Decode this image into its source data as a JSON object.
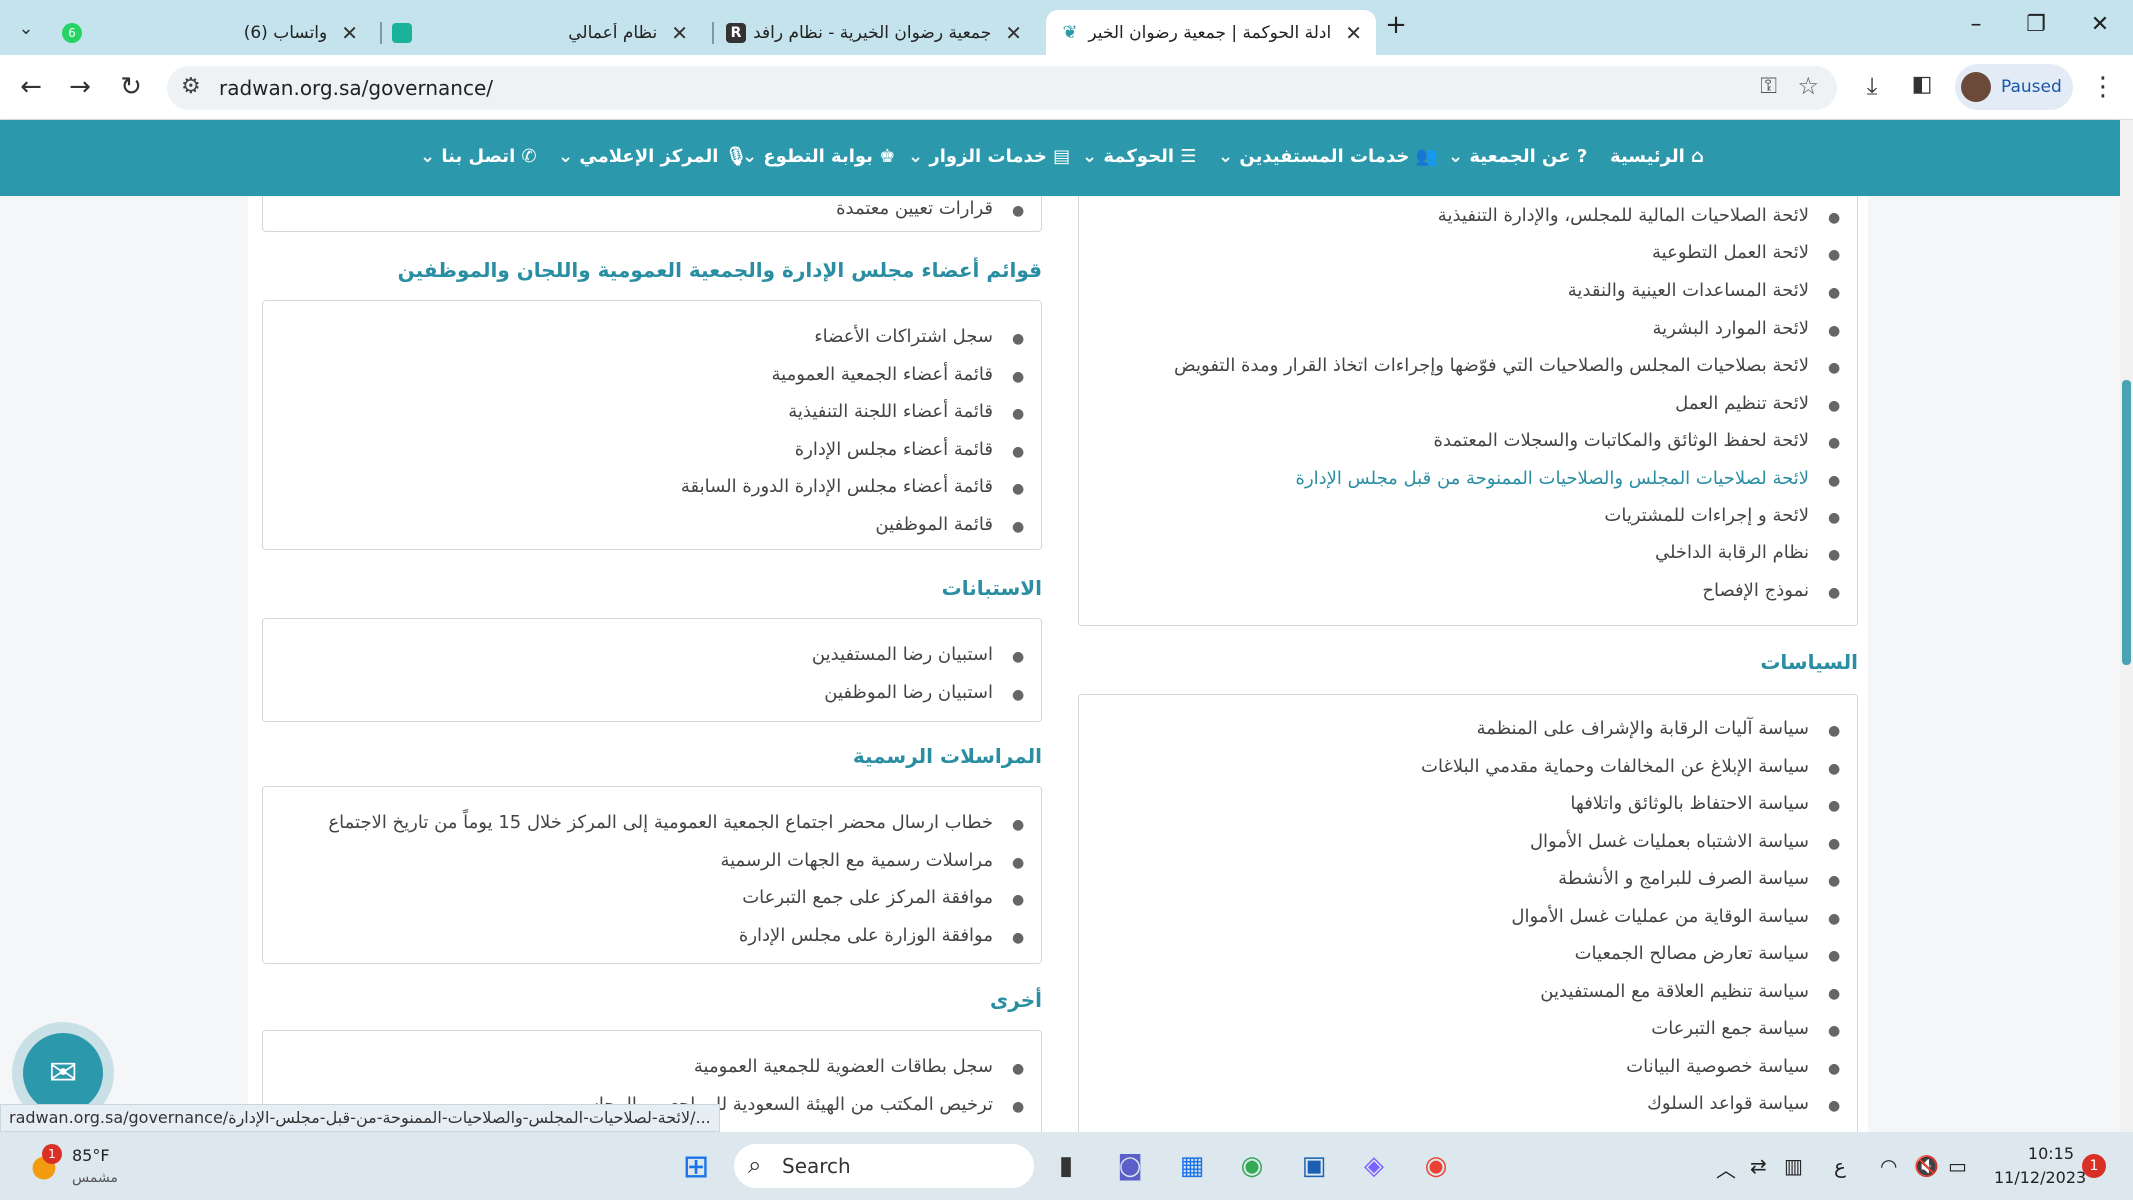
{
  "browser": {
    "tabs": [
      {
        "label": "(6) واتساب",
        "badge": "6"
      },
      {
        "label": "نظام أعمالي"
      },
      {
        "label": "جمعية رضوان الخيرية - نظام رافد"
      },
      {
        "label": "ادلة الحوكمة | جمعية رضوان الخير"
      }
    ],
    "new_tab": "+",
    "url": "radwan.org.sa/governance/",
    "profile": "Paused"
  },
  "menu": [
    "الرئيسية",
    "عن الجمعية",
    "خدمات المستفيدين",
    "الحوكمة",
    "خدمات الزوار",
    "بوابة التطوع",
    "المركز الإعلامي",
    "اتصل بنا"
  ],
  "right_col": {
    "regulations": [
      "لائحة الصلاحيات المالية للمجلس، والإدارة التنفيذية",
      "لائحة العمل التطوعية",
      "لائحة المساعدات العينية والنقدية",
      "لائحة الموارد البشرية",
      "لائحة بصلاحيات المجلس والصلاحيات التي فوّضها وإجراءات اتخاذ القرار ومدة التفويض",
      "لائحة تنظيم العمل",
      "لائحة لحفظ الوثائق والمكاتبات والسجلات المعتمدة",
      "لائحة لصلاحيات المجلس والصلاحيات الممنوحة من قبل مجلس الإدارة",
      "لائحة و إجراءات للمشتريات",
      "نظام الرقابة الداخلي",
      "نموذج الإفصاح"
    ],
    "policies_title": "السياسات",
    "policies": [
      "سياسة آليات الرقابة والإشراف على المنظمة",
      "سياسة الإبلاغ عن المخالفات وحماية مقدمي البلاغات",
      "سياسة الاحتفاظ بالوثائق واتلافها",
      "سياسة الاشتباه بعمليات غسل الأموال",
      "سياسة الصرف للبرامج و الأنشطة",
      "سياسة الوقاية من عمليات غسل الأموال",
      "سياسة تعارض مصالح الجمعيات",
      "سياسة تنظيم العلاقة مع المستفيدين",
      "سياسة جمع التبرعات",
      "سياسة خصوصية البيانات",
      "سياسة قواعد السلوك"
    ]
  },
  "left_col": {
    "top_item": "قرارات تعيين معتمدة",
    "lists_title": "قوائم أعضاء مجلس الإدارة والجمعية العمومية واللجان والموظفين",
    "lists": [
      "سجل اشتراكات الأعضاء",
      "قائمة أعضاء الجمعية العمومية",
      "قائمة أعضاء اللجنة التنفيذية",
      "قائمة أعضاء مجلس الإدارة",
      "قائمة أعضاء مجلس الإدارة الدورة السابقة",
      "قائمة الموظفين"
    ],
    "surveys_title": "الاستبانات",
    "surveys": [
      "استبيان رضا المستفيدين",
      "استبيان رضا الموظفين"
    ],
    "corr_title": "المراسلات الرسمية",
    "corr": [
      "خطاب ارسال محضر اجتماع الجمعية العمومية إلى المركز خلال 15 يوماً من تاريخ الاجتماع",
      "مراسلات رسمية مع الجهات الرسمية",
      "موافقة المركز على جمع التبرعات",
      "موافقة الوزارة على مجلس الإدارة"
    ],
    "other_title": "أخرى",
    "other": [
      "سجل بطاقات العضوية للجمعية العمومية",
      "ترخيص المكتب من الهيئة السعودية للمراجعين والمحاسبين"
    ]
  },
  "status_url": "radwan.org.sa/governance/لائحة-لصلاحيات-المجلس-والصلاحيات-الممنوحة-من-قبل-مجلس-الإدارة/...",
  "taskbar": {
    "weather_temp": "85°F",
    "weather_desc": "مشمس",
    "weather_badge": "1",
    "search": "Search",
    "lang": "ع",
    "time": "10:15",
    "date": "11/12/2023",
    "notif": "1"
  },
  "colors": {
    "primary": "#2c98ac",
    "link": "#2a8ea3"
  }
}
